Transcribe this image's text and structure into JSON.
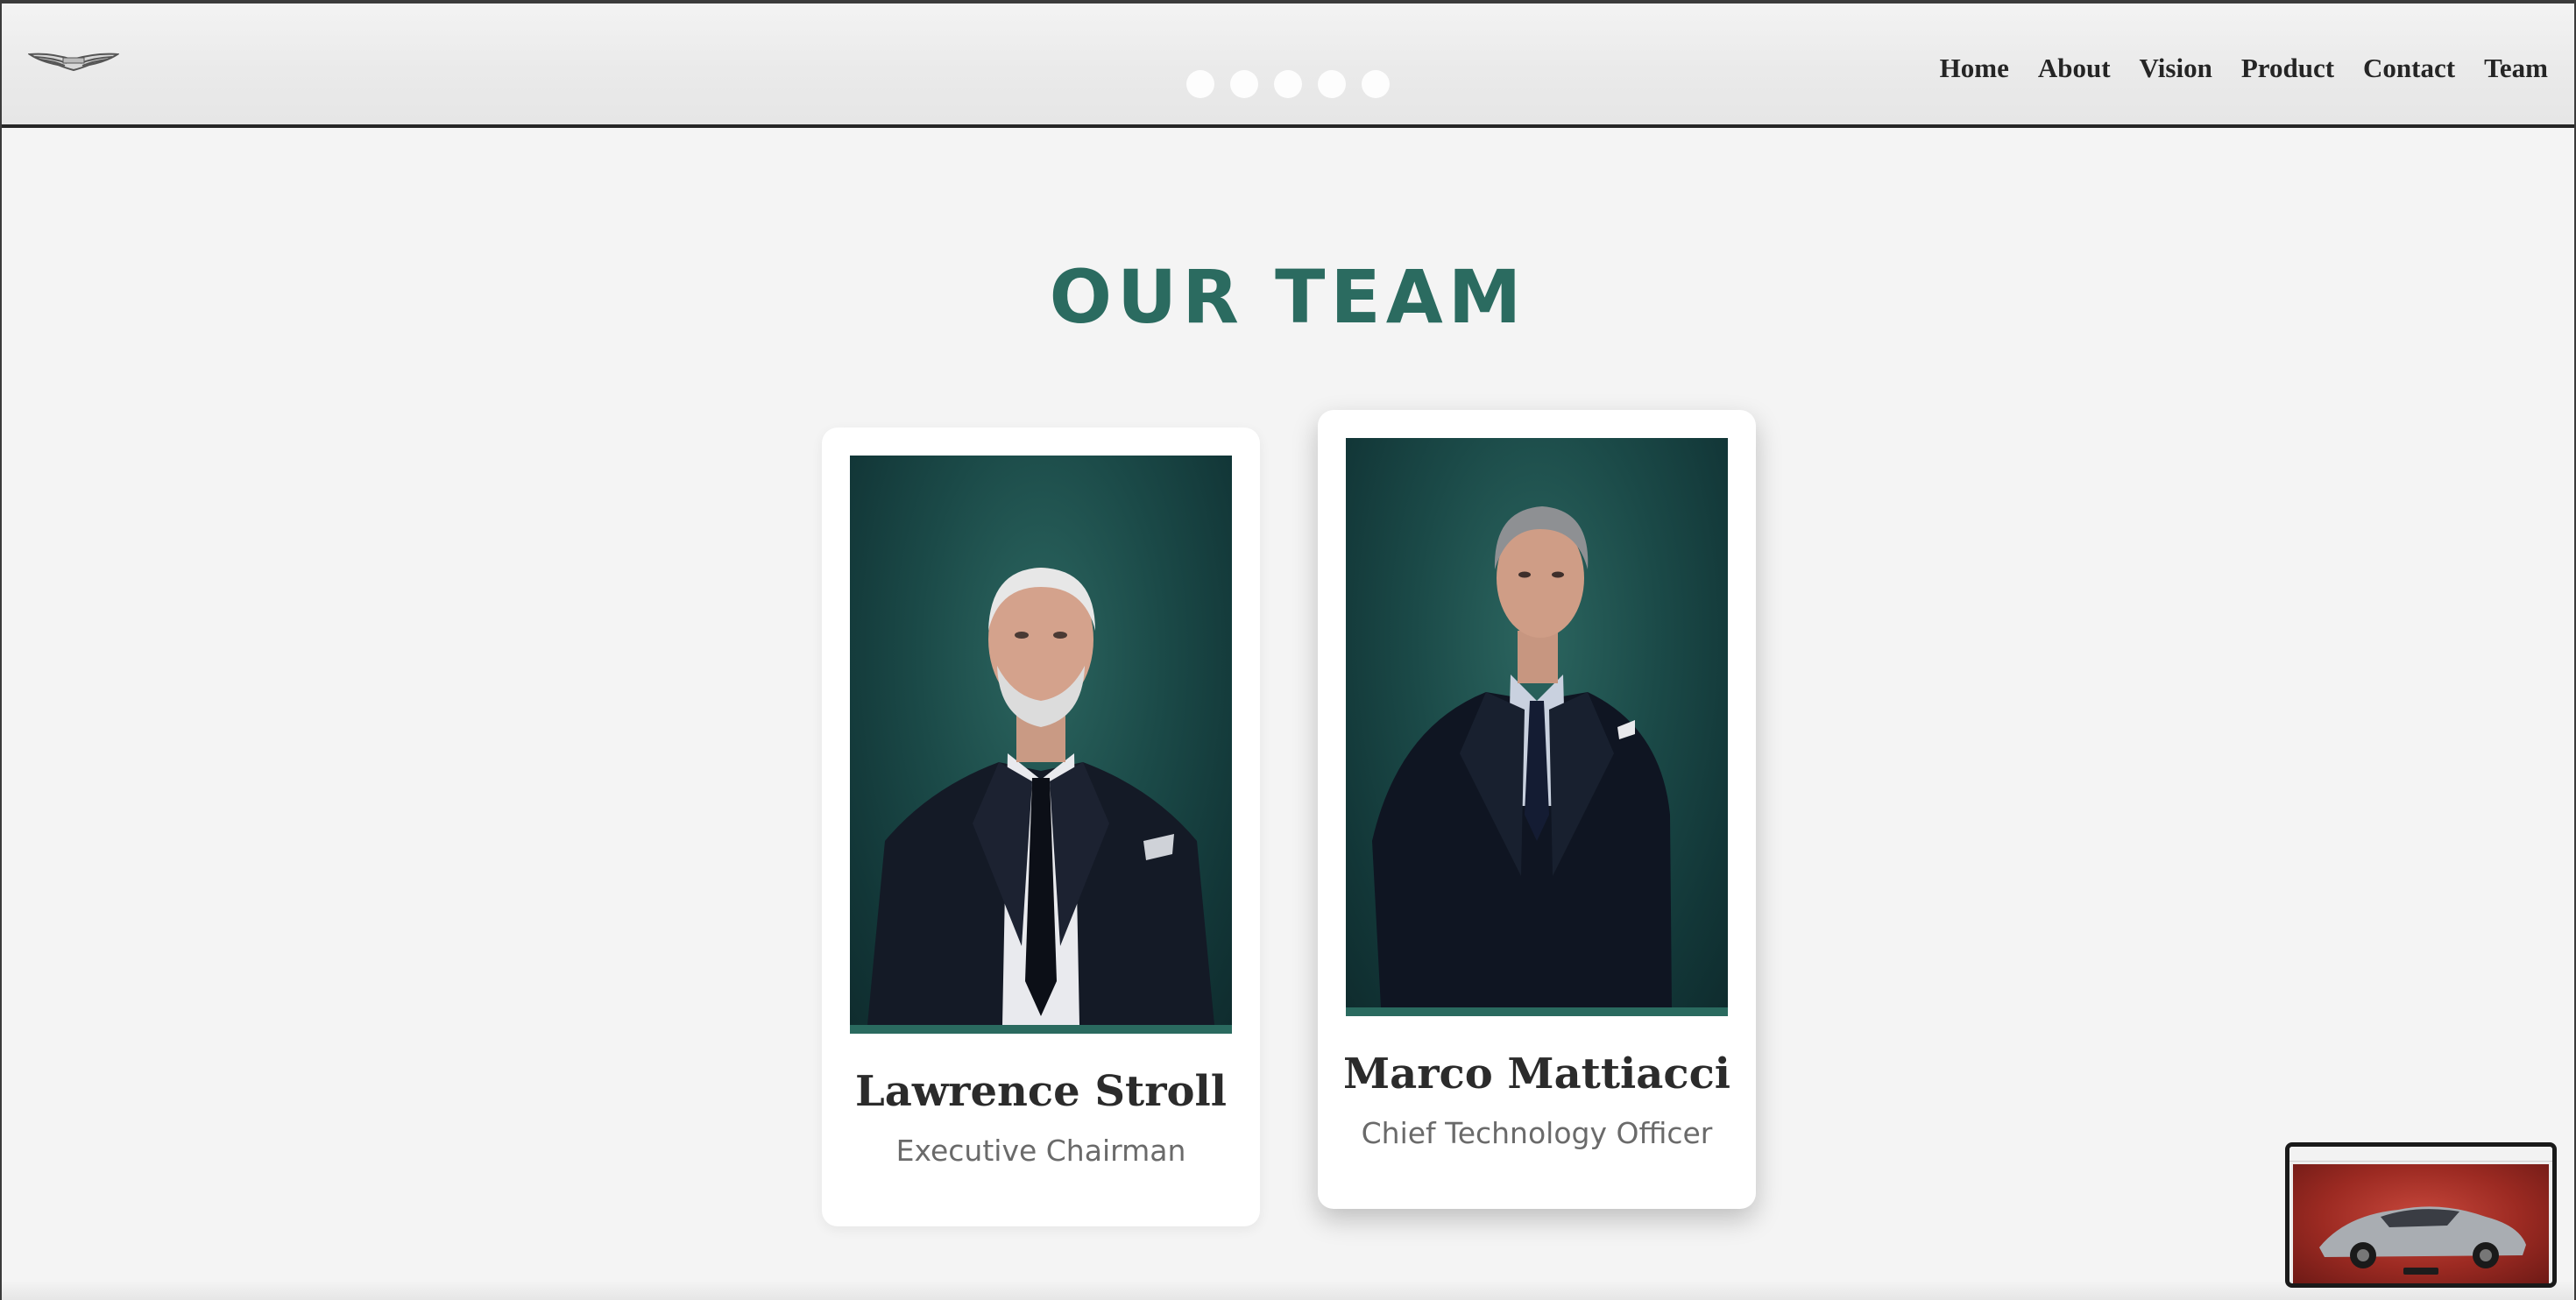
{
  "header": {
    "logo_icon": "wings-logo-icon",
    "carousel_dots": 5,
    "nav": [
      {
        "label": "Home"
      },
      {
        "label": "About"
      },
      {
        "label": "Vision"
      },
      {
        "label": "Product"
      },
      {
        "label": "Contact"
      },
      {
        "label": "Team"
      }
    ]
  },
  "section": {
    "title": "OUR TEAM"
  },
  "team": [
    {
      "name": "Lawrence Stroll",
      "role": "Executive Chairman"
    },
    {
      "name": "Marco Mattiacci",
      "role": "Chief Technology Officer"
    }
  ],
  "colors": {
    "accent": "#2b6b60",
    "nav_text": "#252525",
    "card_bg": "#ffffff",
    "page_bg": "#f4f4f4"
  }
}
